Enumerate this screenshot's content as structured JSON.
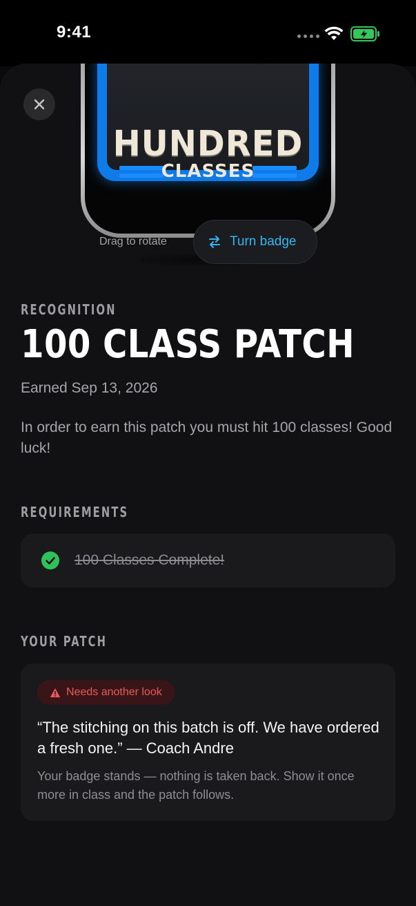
{
  "status_bar": {
    "time": "9:41",
    "battery_color": "#34c759"
  },
  "badge": {
    "line1": "HUNDRED",
    "line2": "CLASSES",
    "accent_color": "#0f7be8"
  },
  "controls": {
    "close_icon": "close-icon",
    "rotate_hint": "Drag to rotate",
    "turn_label": "Turn badge",
    "turn_icon": "swap-arrows-icon",
    "accent": "#35b6f0"
  },
  "details": {
    "eyebrow": "RECOGNITION",
    "title": "100 CLASS PATCH",
    "earned": "Earned Sep 13, 2026",
    "description": "In order to earn this patch you must hit 100 classes! Good luck!"
  },
  "requirements": {
    "heading": "REQUIREMENTS",
    "items": [
      {
        "label": "100 Classes Complete!",
        "complete": true,
        "icon": "check-circle-icon",
        "icon_color": "#30c25a"
      }
    ]
  },
  "patch": {
    "heading": "YOUR PATCH",
    "status_label": "Needs another look",
    "status_icon": "warning-icon",
    "status_color": "#e85a5a",
    "quote": "“The stitching on this batch is off. We have ordered a fresh one.” — Coach Andre",
    "note": "Your badge stands — nothing is taken back. Show it once more in class and the patch follows."
  }
}
